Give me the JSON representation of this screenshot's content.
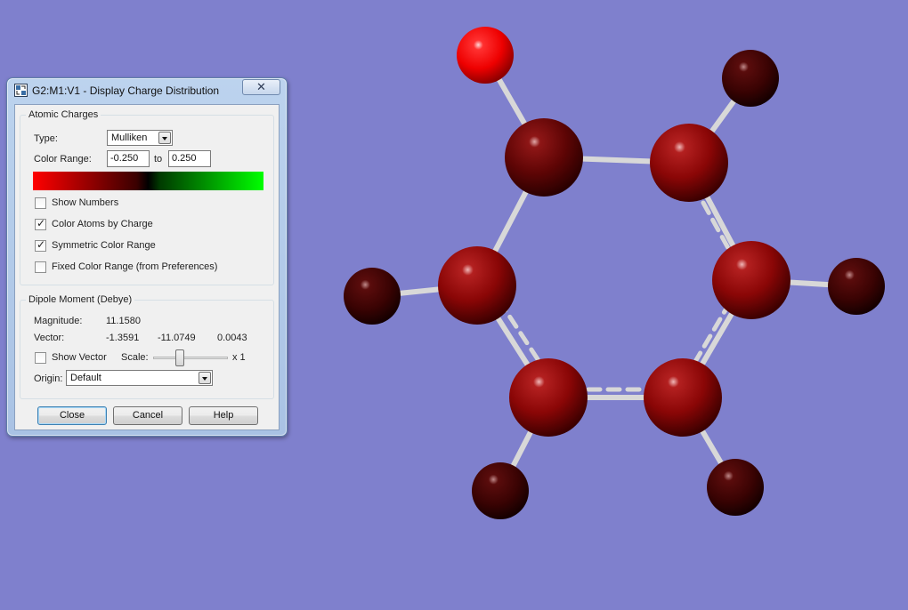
{
  "colors": {
    "background": "#7f80cd",
    "bond": "#d8d8d8",
    "oxygen_atom": "#ff0000",
    "ring_carbon_atom": "#8a0606",
    "hydrogen_atom": "#3a0303",
    "gradient_negative": "#ff0000",
    "gradient_zero": "#000000",
    "gradient_positive": "#00ff00"
  },
  "dialog": {
    "title": "G2:M1:V1 - Display Charge Distribution",
    "close_symbol": "✕",
    "atomic_charges": {
      "group_label": "Atomic Charges",
      "type_label": "Type:",
      "type_value": "Mulliken",
      "color_range_label": "Color Range:",
      "range_min": "-0.250",
      "range_to": "to",
      "range_max": "0.250",
      "show_numbers": {
        "label": "Show Numbers",
        "checked": false
      },
      "color_atoms_by_charge": {
        "label": "Color Atoms by Charge",
        "checked": true
      },
      "symmetric_color_range": {
        "label": "Symmetric Color Range",
        "checked": true
      },
      "fixed_color_range": {
        "label": "Fixed Color Range (from Preferences)",
        "checked": false
      }
    },
    "dipole": {
      "group_label": "Dipole Moment (Debye)",
      "magnitude_label": "Magnitude:",
      "magnitude_value": "11.1580",
      "vector_label": "Vector:",
      "vector_x": "-1.3591",
      "vector_y": "-11.0749",
      "vector_z": "0.0043",
      "show_vector": {
        "label": "Show Vector",
        "checked": false
      },
      "scale_label": "Scale:",
      "scale_value": "x 1",
      "origin_label": "Origin:",
      "origin_value": "Default"
    },
    "buttons": {
      "close": "Close",
      "cancel": "Cancel",
      "help": "Help"
    }
  }
}
